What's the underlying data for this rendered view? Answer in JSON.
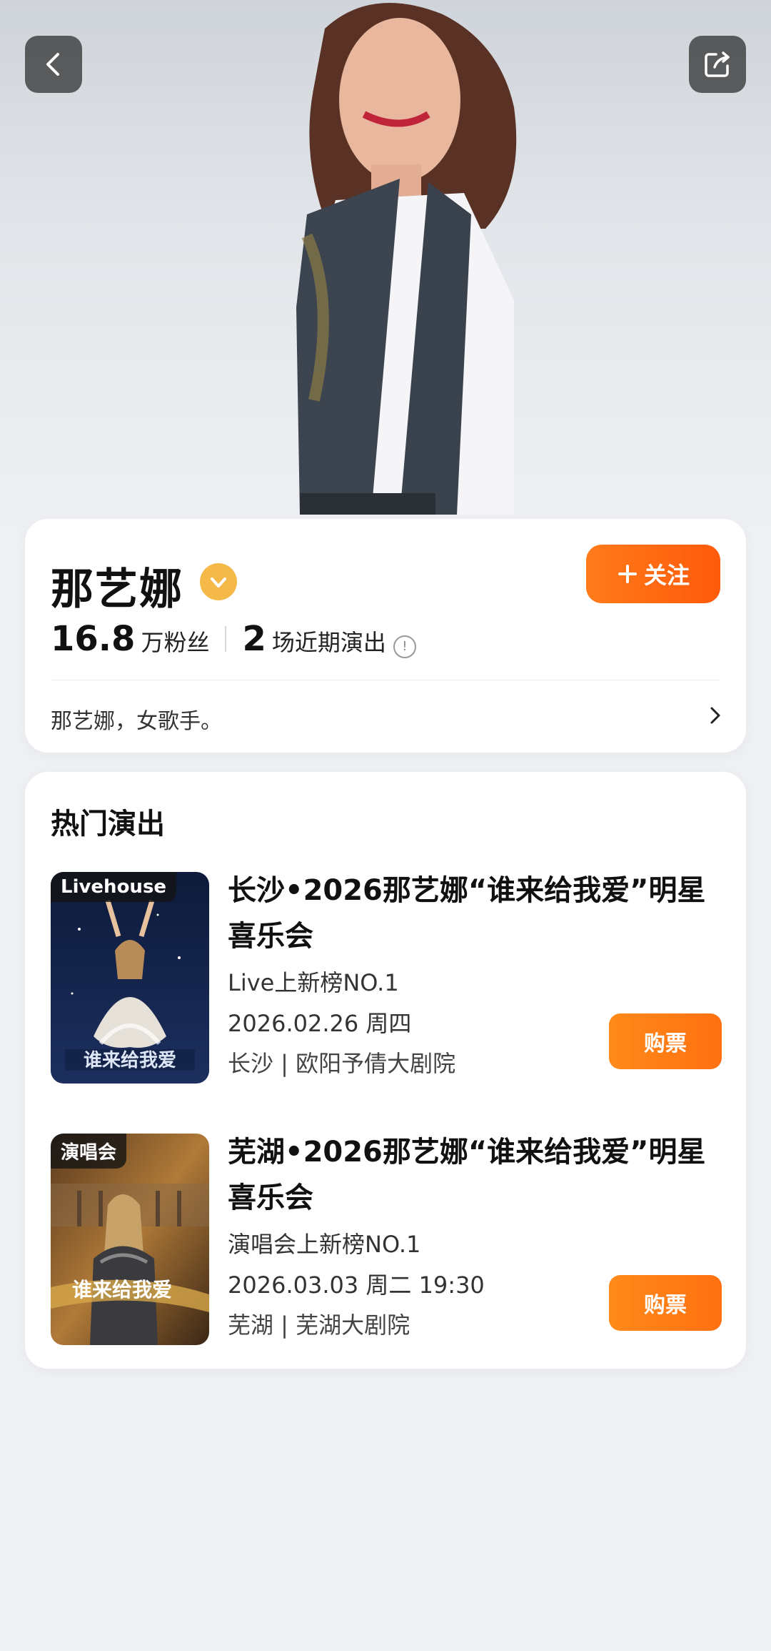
{
  "header": {
    "back_icon": "chevron-left-icon",
    "share_icon": "share-icon"
  },
  "artist": {
    "name": "那艺娜",
    "verified_icon": "verified-badge-icon",
    "follow_label": "关注",
    "fans_count": "16.8",
    "fans_unit": "万粉丝",
    "shows_count": "2",
    "shows_unit": "场近期演出",
    "bio": "那艺娜，女歌手。"
  },
  "hot_shows": {
    "title": "热门演出",
    "items": [
      {
        "tag": "Livehouse",
        "title": "长沙•2026那艺娜“谁来给我爱”明星喜乐会",
        "rank": "Live上新榜NO.1",
        "date": "2026.02.26 周四",
        "venue": "长沙 | 欧阳予倩大剧院",
        "buy_label": "购票"
      },
      {
        "tag": "演唱会",
        "title": "芜湖•2026那艺娜“谁来给我爱”明星喜乐会",
        "rank": "演唱会上新榜NO.1",
        "date": "2026.03.03 周二 19:30",
        "venue": "芜湖 | 芜湖大剧院",
        "buy_label": "购票"
      }
    ]
  },
  "colors": {
    "accent": "#ff6a10",
    "verified": "#f5b94a"
  }
}
